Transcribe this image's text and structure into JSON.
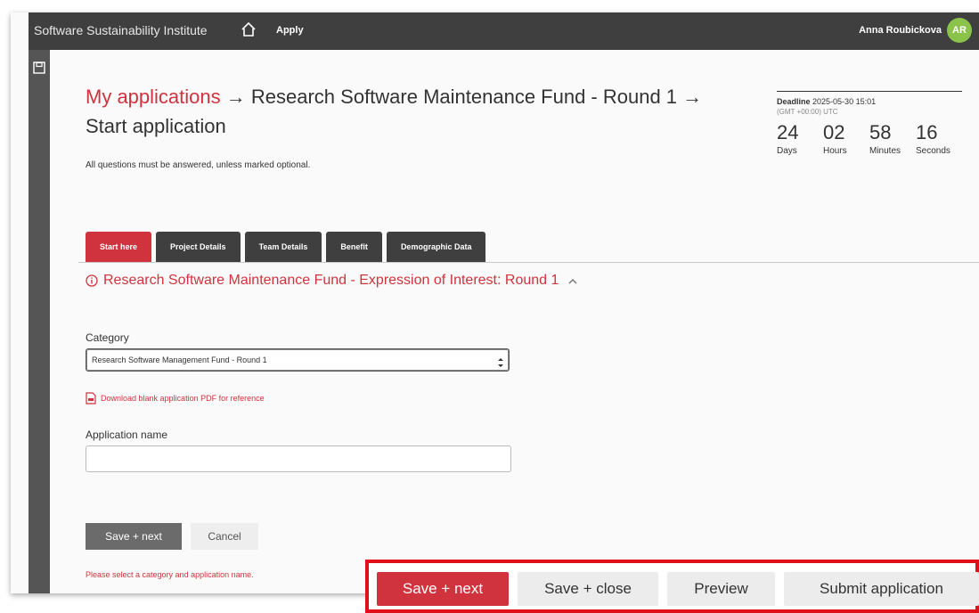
{
  "header": {
    "brand": "Software Sustainability Institute",
    "apply": "Apply",
    "user_name": "Anna Roubickova",
    "avatar_initials": "AR"
  },
  "breadcrumb": {
    "link": "My applications",
    "fund": "Research Software Maintenance Fund - Round 1",
    "current": "Start application",
    "arrow": "→"
  },
  "note": "All questions must be answered, unless marked optional.",
  "deadline": {
    "label": "Deadline",
    "datetime": "2025-05-30 15:01",
    "timezone": "(GMT +00:00) UTC",
    "countdown": [
      {
        "value": "24",
        "unit": "Days"
      },
      {
        "value": "02",
        "unit": "Hours"
      },
      {
        "value": "58",
        "unit": "Minutes"
      },
      {
        "value": "16",
        "unit": "Seconds"
      }
    ]
  },
  "tabs": [
    {
      "label": "Start here",
      "active": true
    },
    {
      "label": "Project Details"
    },
    {
      "label": "Team Details"
    },
    {
      "label": "Benefit"
    },
    {
      "label": "Demographic Data"
    }
  ],
  "section": {
    "title": "Research Software Maintenance Fund - Expression of Interest: Round 1"
  },
  "form": {
    "category_label": "Category",
    "category_value": "Research Software Management Fund - Round 1",
    "pdf_link": "Download blank application PDF for reference",
    "app_name_label": "Application name",
    "app_name_value": "",
    "save_next": "Save + next",
    "cancel": "Cancel",
    "error": "Please select a category and application name."
  },
  "action_bar": {
    "save_next": "Save + next",
    "save_close": "Save + close",
    "preview": "Preview",
    "submit": "Submit application"
  },
  "colors": {
    "accent": "#d0333e",
    "dark": "#3f3f3f",
    "highlight_border": "#e0101a",
    "avatar": "#8bc34a"
  }
}
